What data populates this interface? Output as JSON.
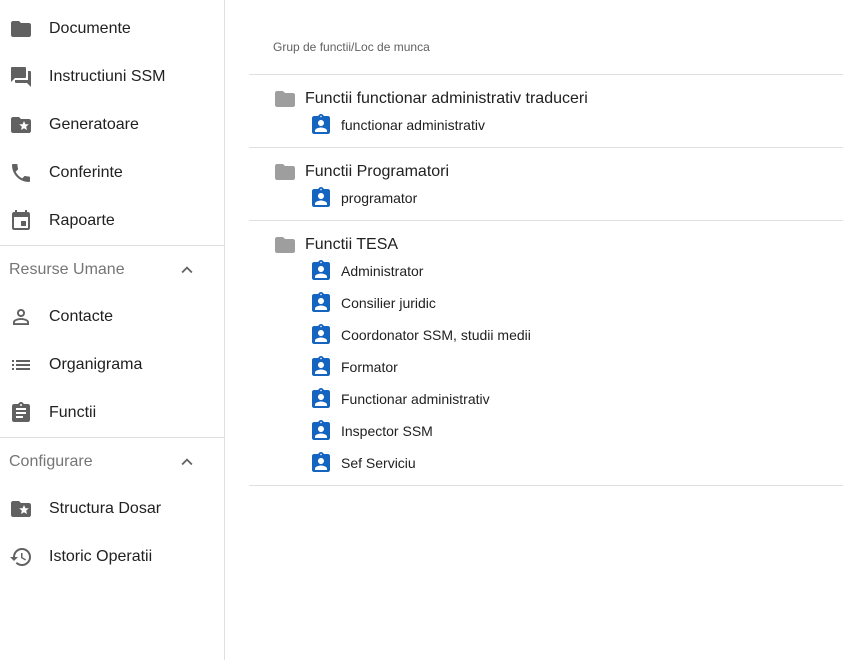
{
  "sidebar": {
    "top_items": [
      {
        "label": "Documente",
        "icon": "folder-icon"
      },
      {
        "label": "Instructiuni SSM",
        "icon": "forum-icon"
      },
      {
        "label": "Generatoare",
        "icon": "folder-star-icon"
      },
      {
        "label": "Conferinte",
        "icon": "phone-icon"
      },
      {
        "label": "Rapoarte",
        "icon": "calendar-icon"
      }
    ],
    "sections": [
      {
        "title": "Resurse Umane",
        "items": [
          {
            "label": "Contacte",
            "icon": "person-icon"
          },
          {
            "label": "Organigrama",
            "icon": "list-icon"
          },
          {
            "label": "Functii",
            "icon": "clipboard-icon"
          }
        ]
      },
      {
        "title": "Configurare",
        "items": [
          {
            "label": "Structura Dosar",
            "icon": "folder-star-icon"
          },
          {
            "label": "Istoric Operatii",
            "icon": "history-icon"
          }
        ]
      }
    ]
  },
  "main": {
    "column_header": "Grup de functii/Loc de munca",
    "groups": [
      {
        "name": "Functii functionar administrativ traduceri",
        "items": [
          "functionar administrativ"
        ]
      },
      {
        "name": "Functii Programatori",
        "items": [
          "programator"
        ]
      },
      {
        "name": "Functii TESA",
        "items": [
          "Administrator",
          "Consilier juridic",
          "Coordonator SSM, studii medii",
          "Formator",
          "Functionar administrativ",
          "Inspector SSM",
          "Sef Serviciu"
        ]
      }
    ]
  },
  "colors": {
    "accent": "#1565c0",
    "icon_grey": "#616161",
    "folder_grey": "#9e9e9e",
    "divider": "#e0e0e0"
  }
}
